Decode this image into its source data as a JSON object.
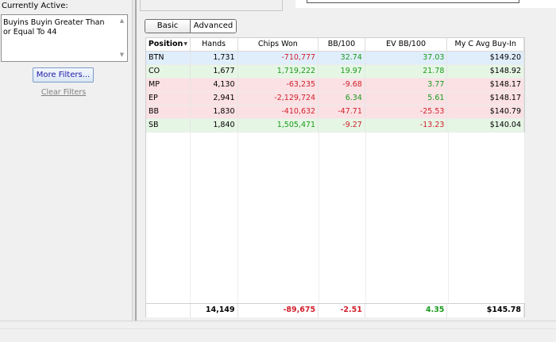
{
  "filters": {
    "currently_active_label": "Currently Active:",
    "active_filter_text": "Buyins Buyin Greater Than or Equal To 44",
    "more_filters_label": "More Filters...",
    "clear_filters_label": "Clear Filters"
  },
  "view_tabs": {
    "basic_label": "Basic",
    "advanced_label": "Advanced",
    "selected": "Basic"
  },
  "table": {
    "columns": [
      "Position",
      "Hands",
      "Chips Won",
      "BB/100",
      "EV BB/100",
      "My C Avg Buy-In"
    ],
    "sorted_column": "Position",
    "rows": [
      {
        "position": "BTN",
        "hands": "1,731",
        "chips_won": "-710,777",
        "bb100": "32.74",
        "ev_bb100": "37.03",
        "avg_buyin": "$149.20",
        "row_color": "#e0eefc"
      },
      {
        "position": "CO",
        "hands": "1,677",
        "chips_won": "1,719,222",
        "bb100": "19.97",
        "ev_bb100": "21.78",
        "avg_buyin": "$148.92",
        "row_color": "#e6f6e4"
      },
      {
        "position": "MP",
        "hands": "4,130",
        "chips_won": "-63,235",
        "bb100": "-9.68",
        "ev_bb100": "3.77",
        "avg_buyin": "$148.17",
        "row_color": "#fbe1e4"
      },
      {
        "position": "EP",
        "hands": "2,941",
        "chips_won": "-2,129,724",
        "bb100": "6.34",
        "ev_bb100": "5.61",
        "avg_buyin": "$148.17",
        "row_color": "#fbe1e4"
      },
      {
        "position": "BB",
        "hands": "1,830",
        "chips_won": "-410,632",
        "bb100": "-47.71",
        "ev_bb100": "-25.53",
        "avg_buyin": "$140.79",
        "row_color": "#fbe1e4"
      },
      {
        "position": "SB",
        "hands": "1,840",
        "chips_won": "1,505,471",
        "bb100": "-9.27",
        "ev_bb100": "-13.23",
        "avg_buyin": "$140.04",
        "row_color": "#e6f6e4"
      }
    ],
    "totals": {
      "hands": "14,149",
      "chips_won": "-89,675",
      "bb100": "-2.51",
      "ev_bb100": "4.35",
      "avg_buyin": "$145.78"
    }
  },
  "colors": {
    "positive_value": "#199b1c",
    "negative_value": "#d01f2b",
    "link_blue": "#1a1aa6"
  }
}
